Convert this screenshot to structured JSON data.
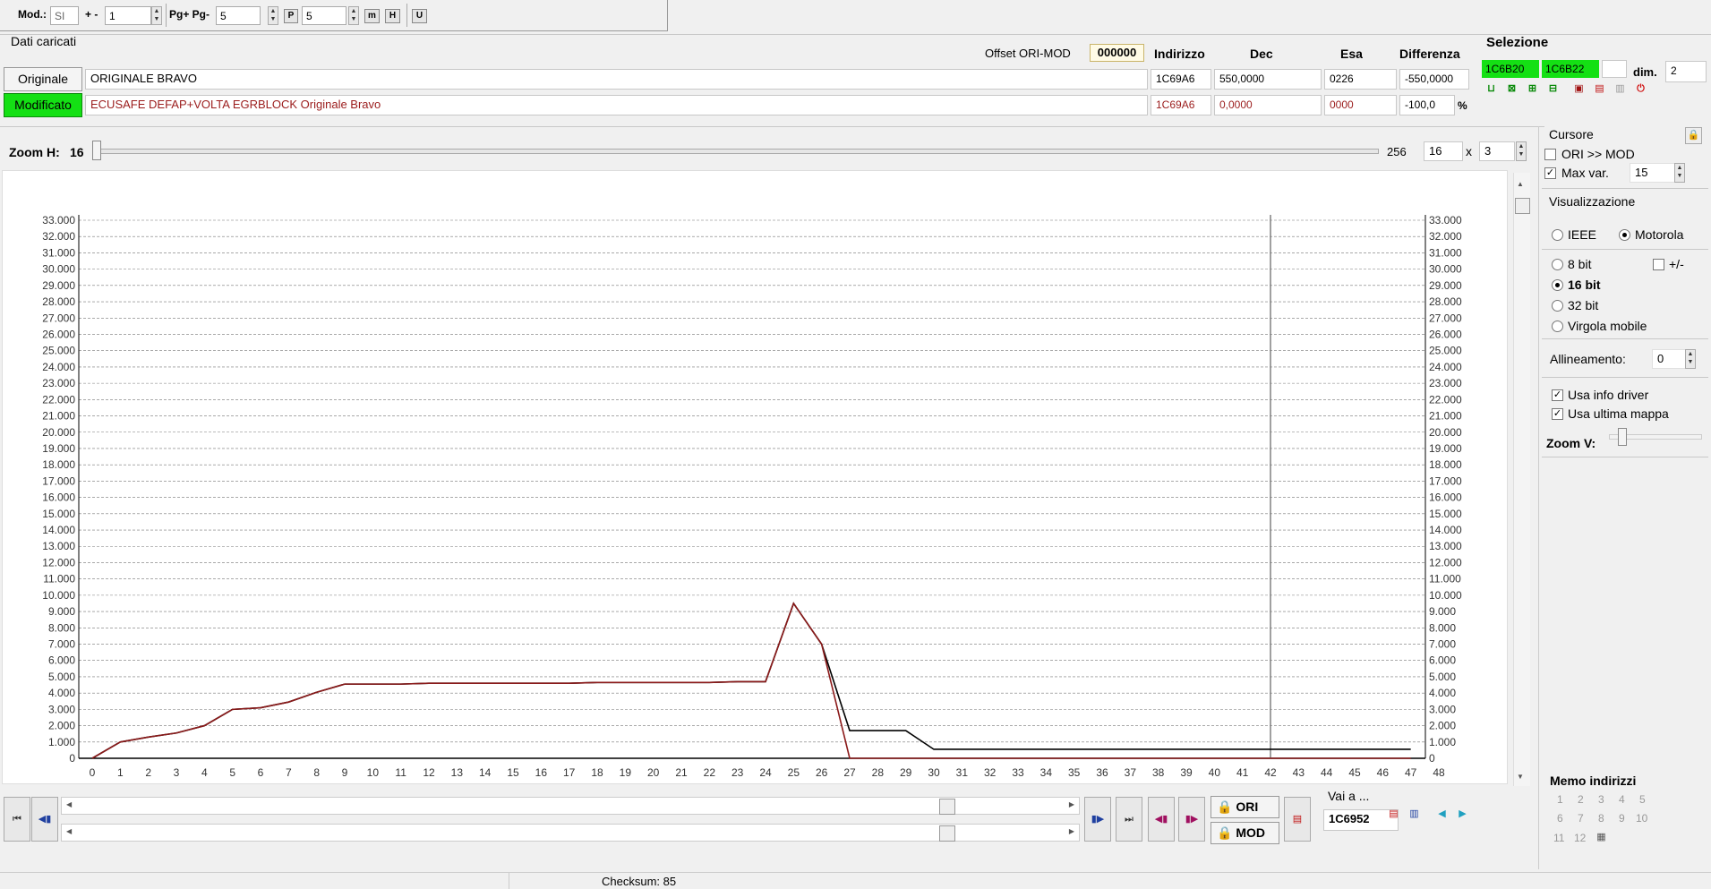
{
  "toolbar": {
    "mod_label": "Mod.:",
    "mod_value": "SI",
    "plusminus_label": "+ -",
    "plusminus_value": "1",
    "pg_label": "Pg+ Pg-",
    "pg_value": "5",
    "p_btn": "P",
    "p_value": "5",
    "m_btn": "m",
    "h_btn": "H",
    "u_btn": "U"
  },
  "loaded": {
    "title": "Dati caricati",
    "offset_label": "Offset ORI-MOD",
    "offset_value": "000000",
    "headers": {
      "address": "Indirizzo",
      "dec": "Dec",
      "hex": "Esa",
      "diff": "Differenza"
    },
    "original": {
      "button": "Originale",
      "name": "ORIGINALE BRAVO",
      "address": "1C69A6",
      "dec": "550,0000",
      "hex": "0226",
      "diff": "-550,0000"
    },
    "modified": {
      "button": "Modificato",
      "name": "ECUSAFE DEFAP+VOLTA EGRBLOCK Originale Bravo",
      "address": "1C69A6",
      "dec": "0,0000",
      "hex": "0000",
      "diff": "-100,0",
      "unit": "%"
    }
  },
  "selection": {
    "title": "Selezione",
    "start": "1C6B20",
    "end": "1C6B22",
    "dim_label": "dim.",
    "dim_value": "2"
  },
  "zoom": {
    "label": "Zoom H:",
    "value": "16",
    "max": "256",
    "cols": "16",
    "x_label": "x",
    "rows": "3"
  },
  "cursor": {
    "title": "Cursore",
    "ori_mod_label": "ORI >> MOD",
    "ori_mod_checked": false,
    "maxvar_label": "Max var.",
    "maxvar_checked": true,
    "maxvar_value": "15"
  },
  "display": {
    "title": "Visualizzazione",
    "ieee": "IEEE",
    "motorola": "Motorola",
    "bit8": "8 bit",
    "sign": "+/-",
    "bit16": "16 bit",
    "bit32": "32 bit",
    "float": "Virgola mobile",
    "align_label": "Allineamento:",
    "align_value": "0",
    "use_driver": "Usa info driver",
    "use_last_map": "Usa ultima mappa",
    "zoomv_label": "Zoom V:"
  },
  "memo": {
    "title": "Memo indirizzi",
    "slots": [
      "1",
      "2",
      "3",
      "4",
      "5",
      "6",
      "7",
      "8",
      "9",
      "10",
      "11",
      "12"
    ]
  },
  "bottom": {
    "ori_btn": "ORI",
    "mod_btn": "MOD",
    "goto_label": "Vai a ...",
    "goto_value": "1C6952",
    "checksum": "Checksum: 85"
  },
  "colors": {
    "original_line": "#000000",
    "modified_line": "#8b1a1a",
    "green": "#00e000",
    "cursor_line": "#808080"
  },
  "chart_data": {
    "type": "line",
    "x": [
      0,
      1,
      2,
      3,
      4,
      5,
      6,
      7,
      8,
      9,
      10,
      11,
      12,
      13,
      14,
      15,
      16,
      17,
      18,
      19,
      20,
      21,
      22,
      23,
      24,
      25,
      26,
      27,
      28,
      29,
      30,
      31,
      32,
      33,
      34,
      35,
      36,
      37,
      38,
      39,
      40,
      41,
      42,
      43,
      44,
      45,
      46,
      47
    ],
    "xlim": [
      0,
      48
    ],
    "ylim": [
      0,
      33000
    ],
    "ytick_step": 1000,
    "grid": true,
    "cursor_x": 42,
    "series": [
      {
        "values": [
          0,
          1000,
          1300,
          1550,
          2000,
          3000,
          3100,
          3450,
          4050,
          4550,
          4550,
          4550,
          4600,
          4600,
          4600,
          4600,
          4600,
          4600,
          4650,
          4650,
          4650,
          4650,
          4650,
          4700,
          4700,
          9500,
          7000,
          1700,
          1700,
          1700,
          550,
          550,
          550,
          550,
          550,
          550,
          550,
          550,
          550,
          550,
          550,
          550,
          550,
          550,
          550,
          550,
          550,
          550
        ]
      },
      {
        "values": [
          0,
          1000,
          1300,
          1550,
          2000,
          3000,
          3100,
          3450,
          4050,
          4550,
          4550,
          4550,
          4600,
          4600,
          4600,
          4600,
          4600,
          4600,
          4650,
          4650,
          4650,
          4650,
          4650,
          4700,
          4700,
          9500,
          7000,
          0,
          0,
          0,
          0,
          0,
          0,
          0,
          0,
          0,
          0,
          0,
          0,
          0,
          0,
          0,
          0,
          0,
          0,
          0,
          0,
          0
        ]
      }
    ]
  }
}
